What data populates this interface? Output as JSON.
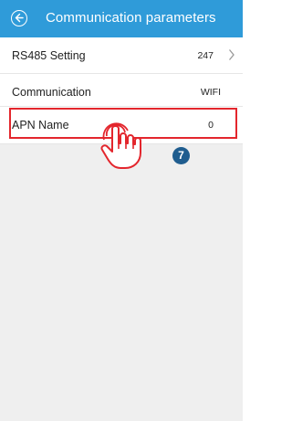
{
  "header": {
    "title": "Communication parameters",
    "back_icon": "back-circle-arrow-icon",
    "background_color": "#2f9bd9"
  },
  "rows": [
    {
      "label": "RS485 Setting",
      "value": "247",
      "icon": "chevron-right-icon"
    },
    {
      "label": "Communication",
      "value": "WIFI"
    },
    {
      "label": "APN Name",
      "value": "0"
    }
  ],
  "annotation": {
    "step_number": "7",
    "pointer_icon": "tapping-hand-icon",
    "highlight_color": "#e3262d"
  }
}
